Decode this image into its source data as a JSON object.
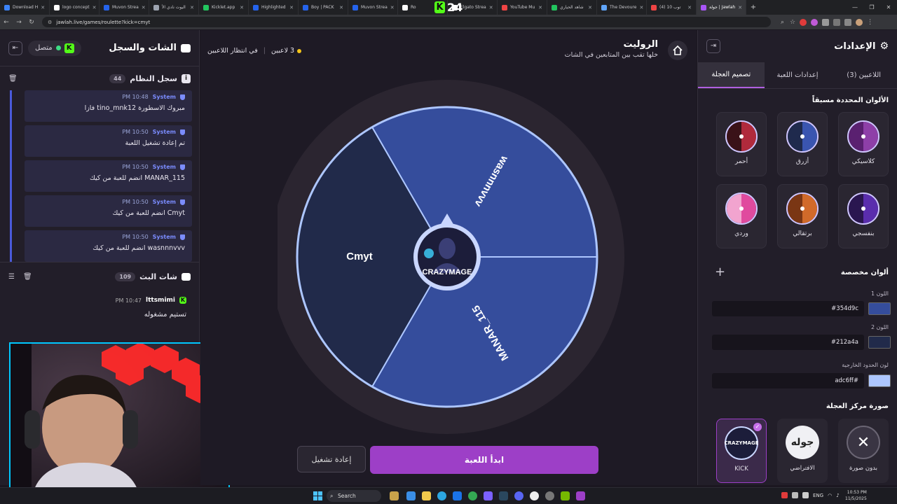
{
  "browser": {
    "tabs": [
      {
        "label": "Download H",
        "color": "#3b82f6"
      },
      {
        "label": "logo concept",
        "color": "#ffffff"
      },
      {
        "label": "Muvon Strea",
        "color": "#2563eb"
      },
      {
        "label": "اليوت نادي الأ",
        "color": "#9ca3af"
      },
      {
        "label": "Kicklet.app",
        "color": "#22c55e"
      },
      {
        "label": "Highlighted",
        "color": "#2563eb"
      },
      {
        "label": "Boy | PACK",
        "color": "#2563eb"
      },
      {
        "label": "Muvon Strea",
        "color": "#2563eb"
      },
      {
        "label": "Ro",
        "color": "#ffffff"
      },
      {
        "label": "Elgato Strea",
        "color": "#ffffff"
      },
      {
        "label": "YouTube Mu",
        "color": "#ef4444"
      },
      {
        "label": "شاهد الحياري",
        "color": "#22c55e"
      },
      {
        "label": "The Devoure",
        "color": "#60a5fa"
      },
      {
        "label": "(4) توب 10",
        "color": "#ef4444"
      },
      {
        "label": "جولة | Jawlah",
        "color": "#a855f7"
      }
    ],
    "kick_overlay": "24",
    "url": "jawlah.live/games/roulette?kick=cmyt"
  },
  "chat_panel": {
    "title": "الشات والسجل",
    "status": "متصل",
    "system_log": {
      "title": "سجل النظام",
      "count": "44",
      "messages": [
        {
          "sender": "System",
          "time": "10:48 PM",
          "text": "مبروك الاسطورة tino_mnk12 فازا"
        },
        {
          "sender": "System",
          "time": "10:50 PM",
          "text": "تم إعادة تشغيل اللعبة"
        },
        {
          "sender": "System",
          "time": "10:50 PM",
          "text": "MANAR_115 انضم للعبة من كيك"
        },
        {
          "sender": "System",
          "time": "10:50 PM",
          "text": "Cmyt انضم للعبة من كيك"
        },
        {
          "sender": "System",
          "time": "10:50 PM",
          "text": "wasnnnvvv انضم للعبة من كيك"
        }
      ]
    },
    "stream_chat": {
      "title": "شات البث",
      "count": "109",
      "messages": [
        {
          "user": "lttsmimi",
          "time": "10:47 PM",
          "text": "تستيم مشغوله"
        }
      ]
    }
  },
  "game": {
    "title": "الروليت",
    "subtitle": "خلها تقب بين المتابعين في الشات",
    "players_count": "3 لاعبين",
    "status": "في انتظار اللاعبين",
    "wheel_segments": [
      {
        "name": "wasnnnvvv",
        "color": "#354d9c"
      },
      {
        "name": "MANAR_115",
        "color": "#354d9c"
      },
      {
        "name": "Cmyt",
        "color": "#212a4a"
      }
    ],
    "center_logo": "CRAZYMAGE",
    "start_button": "ابدأ اللعبة",
    "restart_button": "إعادة تشغيل"
  },
  "settings_panel": {
    "title": "الإعدادات",
    "tabs": [
      {
        "label": "اللاعبين (3)",
        "active": false
      },
      {
        "label": "إعدادات اللعبة",
        "active": false
      },
      {
        "label": "تصميم العجلة",
        "active": true
      }
    ],
    "preset_title": "الألوان المحددة مسبقاً",
    "presets": [
      {
        "name": "كلاسيكي",
        "c1": "#8e3fa8",
        "c2": "#5a2070"
      },
      {
        "name": "أزرق",
        "c1": "#3a55b0",
        "c2": "#1f2a4d"
      },
      {
        "name": "أحمر",
        "c1": "#b02a3c",
        "c2": "#3a1218"
      },
      {
        "name": "بنفسجي",
        "c1": "#5a2dad",
        "c2": "#2a1650"
      },
      {
        "name": "برتقالي",
        "c1": "#d16a2a",
        "c2": "#7a3614"
      },
      {
        "name": "وردي",
        "c1": "#e04a9e",
        "c2": "#f2a4cf"
      }
    ],
    "custom_title": "ألوان مخصصة",
    "color1_label": "اللون 1",
    "color1_value": "#354d9c",
    "color2_label": "اللون 2",
    "color2_value": "#212a4a",
    "border_label": "لون الحدود الخارجية",
    "border_value": "adc6ff#",
    "border_color": "#adc6ff",
    "center_image_title": "صورة مركز العجلة",
    "center_options": [
      {
        "name": "بدون صورة",
        "icon": "close-icon"
      },
      {
        "name": "الافتراضي",
        "icon": "jawlah-logo"
      },
      {
        "name": "KICK",
        "icon": "crazymage-logo"
      }
    ],
    "default_logo_text": "جوله"
  },
  "taskbar": {
    "search": "Search",
    "lang": "ENG",
    "time": "10:53 PM",
    "date": "11/5/2025"
  }
}
